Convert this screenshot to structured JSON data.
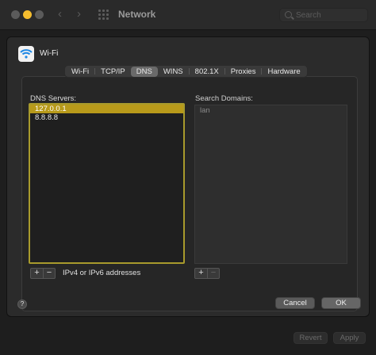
{
  "window": {
    "title": "Network"
  },
  "search": {
    "placeholder": "Search"
  },
  "network": {
    "name": "Wi-Fi"
  },
  "tabs": [
    {
      "label": "Wi-Fi"
    },
    {
      "label": "TCP/IP"
    },
    {
      "label": "DNS",
      "active": true
    },
    {
      "label": "WINS"
    },
    {
      "label": "802.1X"
    },
    {
      "label": "Proxies"
    },
    {
      "label": "Hardware"
    }
  ],
  "dns": {
    "label": "DNS Servers:",
    "servers": [
      "127.0.0.1",
      "8.8.8.8"
    ],
    "selected_index": 0,
    "hint": "IPv4 or IPv6 addresses"
  },
  "search_domains": {
    "label": "Search Domains:",
    "entries": [
      "lan"
    ]
  },
  "buttons": {
    "add": "+",
    "remove": "−",
    "help": "?",
    "cancel": "Cancel",
    "ok": "OK",
    "revert": "Revert",
    "apply": "Apply"
  },
  "colors": {
    "accent_selection": "#b89a1a",
    "focus_ring": "#a89a2c",
    "minimize_light": "#f5bd2e"
  }
}
